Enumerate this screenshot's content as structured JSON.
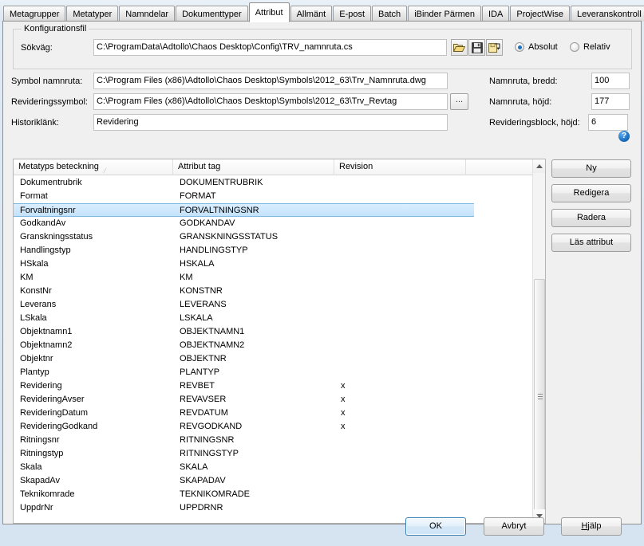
{
  "tabs": [
    {
      "label": "Metagrupper",
      "active": false
    },
    {
      "label": "Metatyper",
      "active": false
    },
    {
      "label": "Namndelar",
      "active": false
    },
    {
      "label": "Dokumenttyper",
      "active": false
    },
    {
      "label": "Attribut",
      "active": true
    },
    {
      "label": "Allmänt",
      "active": false
    },
    {
      "label": "E-post",
      "active": false
    },
    {
      "label": "Batch",
      "active": false
    },
    {
      "label": "iBinder Pärmen",
      "active": false
    },
    {
      "label": "IDA",
      "active": false
    },
    {
      "label": "ProjectWise",
      "active": false
    },
    {
      "label": "Leveranskontroll",
      "active": false
    }
  ],
  "tab_nav": {
    "prev_icon": "triangle-left-icon",
    "next_icon": "triangle-right-icon"
  },
  "config_group": {
    "title": "Konfigurationsfil",
    "path_label": "Sökväg:",
    "path_value": "C:\\ProgramData\\Adtollo\\Chaos Desktop\\Config\\TRV_namnruta.cs",
    "icons": [
      {
        "name": "open-folder-icon",
        "glyph": "open"
      },
      {
        "name": "save-icon",
        "glyph": "save"
      },
      {
        "name": "save-as-icon",
        "glyph": "saveas"
      }
    ],
    "radios": [
      {
        "label": "Absolut",
        "checked": true
      },
      {
        "label": "Relativ",
        "checked": false
      }
    ]
  },
  "fields": {
    "symbol_label": "Symbol namnruta:",
    "symbol_value": "C:\\Program Files (x86)\\Adtollo\\Chaos Desktop\\Symbols\\2012_63\\Trv_Namnruta.dwg",
    "revision_symbol_label": "Revideringssymbol:",
    "revision_symbol_value": "C:\\Program Files (x86)\\Adtollo\\Chaos Desktop\\Symbols\\2012_63\\Trv_Revtag",
    "revision_browse_label": "...",
    "history_label": "Historiklänk:",
    "history_value": "Revidering",
    "width_label": "Namnruta, bredd:",
    "width_value": "100",
    "height_label": "Namnruta, höjd:",
    "height_value": "177",
    "revblock_label": "Revideringsblock, höjd:",
    "revblock_value": "6",
    "help_glyph": "?"
  },
  "list": {
    "columns": [
      {
        "label": "Metatyps beteckning",
        "sorted": true,
        "sort_glyph": "⁄"
      },
      {
        "label": "Attribut tag"
      },
      {
        "label": "Revision"
      },
      {
        "label": ""
      }
    ],
    "rows": [
      {
        "name": "Dokumentrubrik",
        "tag": "DOKUMENTRUBRIK",
        "revision": "",
        "selected": false
      },
      {
        "name": "Format",
        "tag": "FORMAT",
        "revision": "",
        "selected": false
      },
      {
        "name": "Forvaltningsnr",
        "tag": "FORVALTNINGSNR",
        "revision": "",
        "selected": true
      },
      {
        "name": "GodkandAv",
        "tag": "GODKANDAV",
        "revision": "",
        "selected": false
      },
      {
        "name": "Granskningsstatus",
        "tag": "GRANSKNINGSSTATUS",
        "revision": "",
        "selected": false
      },
      {
        "name": "Handlingstyp",
        "tag": "HANDLINGSTYP",
        "revision": "",
        "selected": false
      },
      {
        "name": "HSkala",
        "tag": "HSKALA",
        "revision": "",
        "selected": false
      },
      {
        "name": "KM",
        "tag": "KM",
        "revision": "",
        "selected": false
      },
      {
        "name": "KonstNr",
        "tag": "KONSTNR",
        "revision": "",
        "selected": false
      },
      {
        "name": "Leverans",
        "tag": "LEVERANS",
        "revision": "",
        "selected": false
      },
      {
        "name": "LSkala",
        "tag": "LSKALA",
        "revision": "",
        "selected": false
      },
      {
        "name": "Objektnamn1",
        "tag": "OBJEKTNAMN1",
        "revision": "",
        "selected": false
      },
      {
        "name": "Objektnamn2",
        "tag": "OBJEKTNAMN2",
        "revision": "",
        "selected": false
      },
      {
        "name": "Objektnr",
        "tag": "OBJEKTNR",
        "revision": "",
        "selected": false
      },
      {
        "name": "Plantyp",
        "tag": "PLANTYP",
        "revision": "",
        "selected": false
      },
      {
        "name": "Revidering",
        "tag": "REVBET",
        "revision": "x",
        "selected": false
      },
      {
        "name": "RevideringAvser",
        "tag": "REVAVSER",
        "revision": "x",
        "selected": false
      },
      {
        "name": "RevideringDatum",
        "tag": "REVDATUM",
        "revision": "x",
        "selected": false
      },
      {
        "name": "RevideringGodkand",
        "tag": "REVGODKAND",
        "revision": "x",
        "selected": false
      },
      {
        "name": "Ritningsnr",
        "tag": "RITNINGSNR",
        "revision": "",
        "selected": false
      },
      {
        "name": "Ritningstyp",
        "tag": "RITNINGSTYP",
        "revision": "",
        "selected": false
      },
      {
        "name": "Skala",
        "tag": "SKALA",
        "revision": "",
        "selected": false
      },
      {
        "name": "SkapadAv",
        "tag": "SKAPADAV",
        "revision": "",
        "selected": false
      },
      {
        "name": "Teknikomrade",
        "tag": "TEKNIKOMRADE",
        "revision": "",
        "selected": false
      },
      {
        "name": "UppdrNr",
        "tag": "UPPDRNR",
        "revision": "",
        "selected": false
      }
    ]
  },
  "side_buttons": [
    {
      "label": "Ny"
    },
    {
      "label": "Redigera"
    },
    {
      "label": "Radera"
    },
    {
      "label": "Läs attribut"
    }
  ],
  "footer_buttons": [
    {
      "label": "OK",
      "default": true
    },
    {
      "label": "Avbryt",
      "default": false
    },
    {
      "label": "Hjälp",
      "default": false,
      "accel": "H"
    }
  ],
  "colors": {
    "accent": "#1f6fc4",
    "selection": "#c4e2fb",
    "window_bg": "#f0f0f0",
    "frame": "#d6e3f0"
  }
}
